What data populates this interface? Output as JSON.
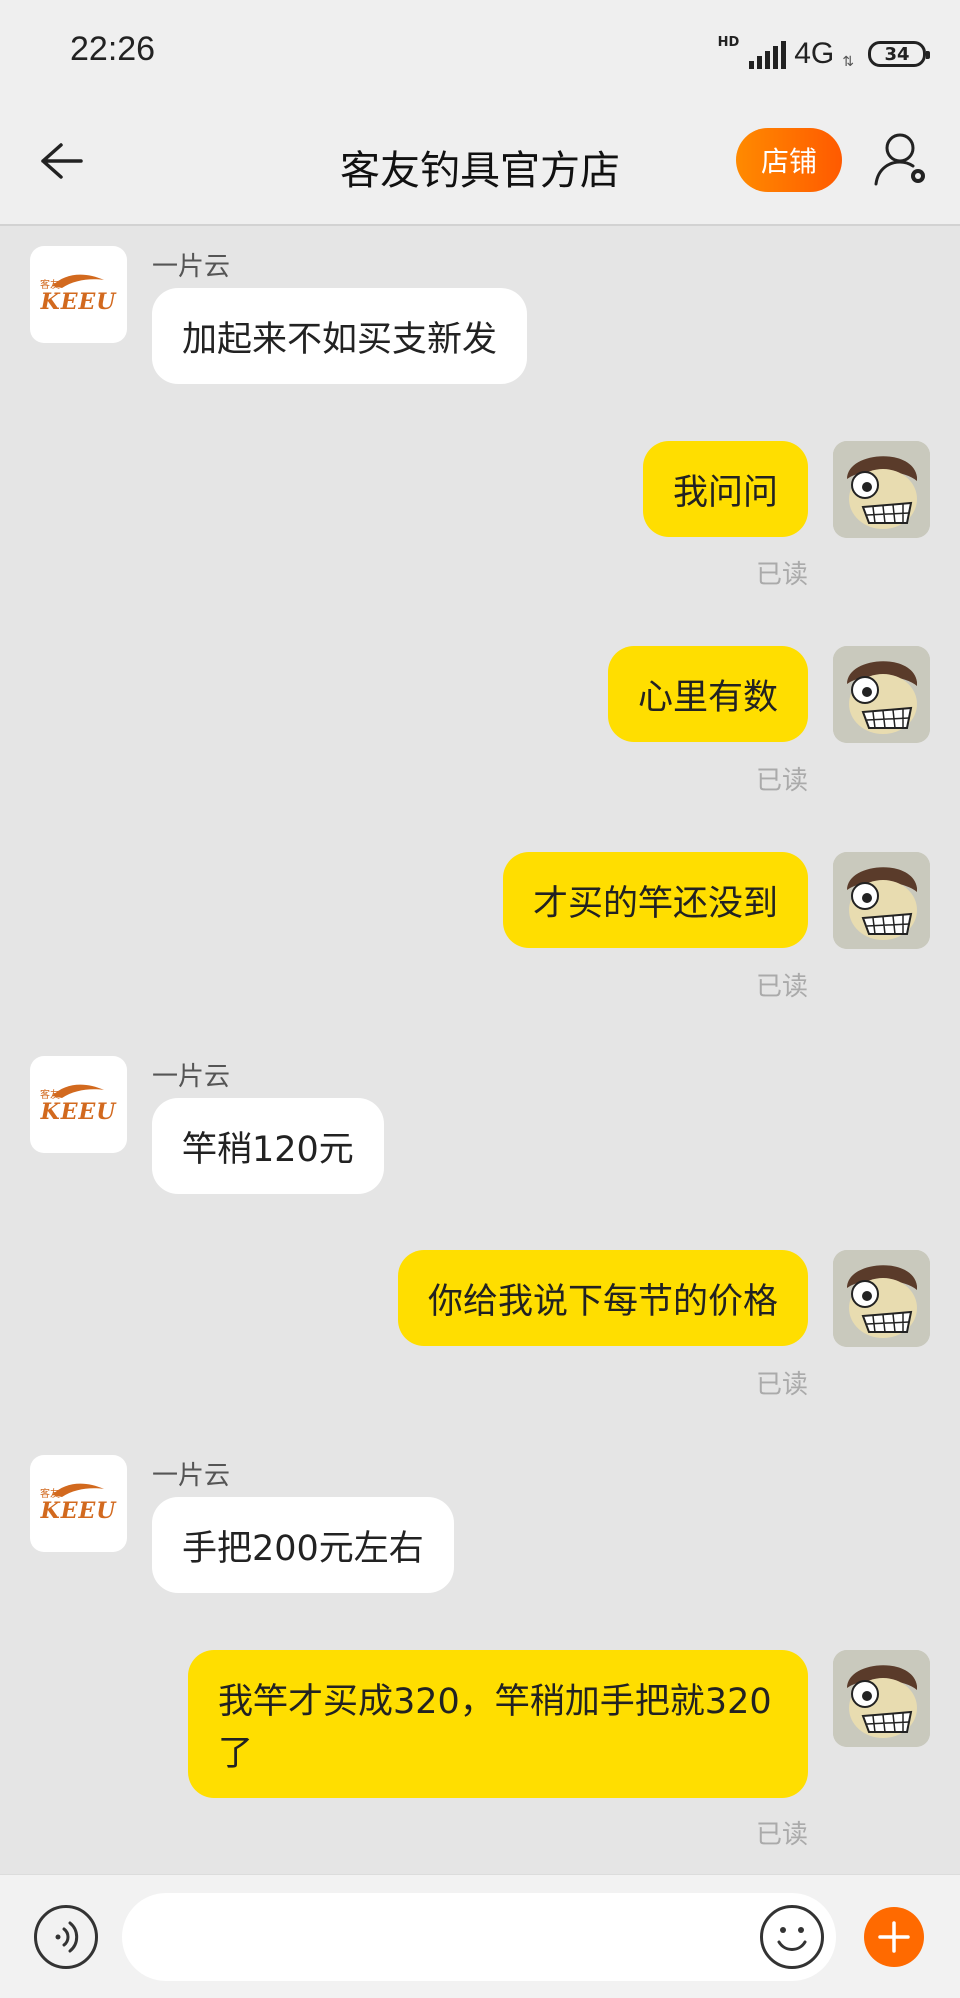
{
  "status_bar": {
    "time": "22:26",
    "hd": "HD",
    "network": "4G",
    "battery": "34"
  },
  "header": {
    "title": "客友钓具官方店",
    "shop_label": "店铺"
  },
  "shop_logo": {
    "brand_small": "客友",
    "brand": "KEEU"
  },
  "messages": [
    {
      "side": "left",
      "sender": "一片云",
      "text": "加起来不如买支新发"
    },
    {
      "side": "right",
      "text": "我问问",
      "status": "已读"
    },
    {
      "side": "right",
      "text": "心里有数",
      "status": "已读"
    },
    {
      "side": "right",
      "text": "才买的竿还没到",
      "status": "已读"
    },
    {
      "side": "left",
      "sender": "一片云",
      "text": "竿稍120元"
    },
    {
      "side": "right",
      "text": "你给我说下每节的价格",
      "status": "已读"
    },
    {
      "side": "left",
      "sender": "一片云",
      "text": "手把200元左右"
    },
    {
      "side": "right",
      "text": "我竿才买成320，竿稍加手把就320了",
      "status": "已读"
    }
  ],
  "input": {
    "placeholder": ""
  },
  "colors": {
    "accent": "#ff6a00",
    "my_bubble": "#ffde00",
    "their_bubble": "#ffffff",
    "background": "#e5e5e5"
  }
}
